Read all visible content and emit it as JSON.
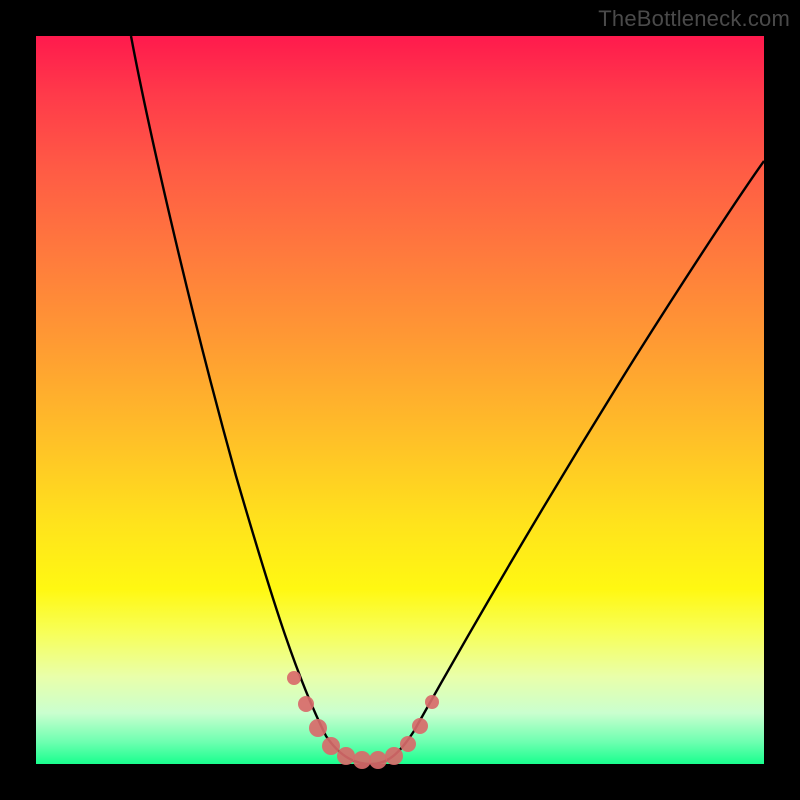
{
  "watermark": "TheBottleneck.com",
  "chart_data": {
    "type": "line",
    "title": "",
    "xlabel": "",
    "ylabel": "",
    "xlim": [
      0,
      100
    ],
    "ylim": [
      0,
      100
    ],
    "grid": false,
    "legend": false,
    "series": [
      {
        "name": "bottleneck-curve",
        "color": "#000000",
        "x": [
          13,
          15,
          18,
          21,
          24,
          27,
          30,
          32,
          34,
          36,
          38,
          40,
          42,
          44,
          46,
          48,
          50,
          54,
          58,
          62,
          66,
          70,
          74,
          78,
          82,
          86,
          90,
          94,
          98,
          100
        ],
        "values": [
          100,
          92,
          80,
          68,
          57,
          46,
          35,
          28,
          22,
          16,
          11,
          7,
          4,
          2,
          1,
          1,
          2,
          4,
          8,
          13,
          18,
          23,
          28,
          33,
          38,
          43,
          48,
          53,
          58,
          60
        ]
      },
      {
        "name": "datapoints",
        "color": "#d86a6a",
        "marker": "circle",
        "x": [
          34,
          36,
          38,
          40,
          42,
          44,
          46,
          48,
          50,
          52,
          54
        ],
        "values": [
          13,
          9,
          5,
          3,
          1.5,
          1,
          1,
          1.5,
          3,
          6,
          10
        ]
      }
    ]
  }
}
